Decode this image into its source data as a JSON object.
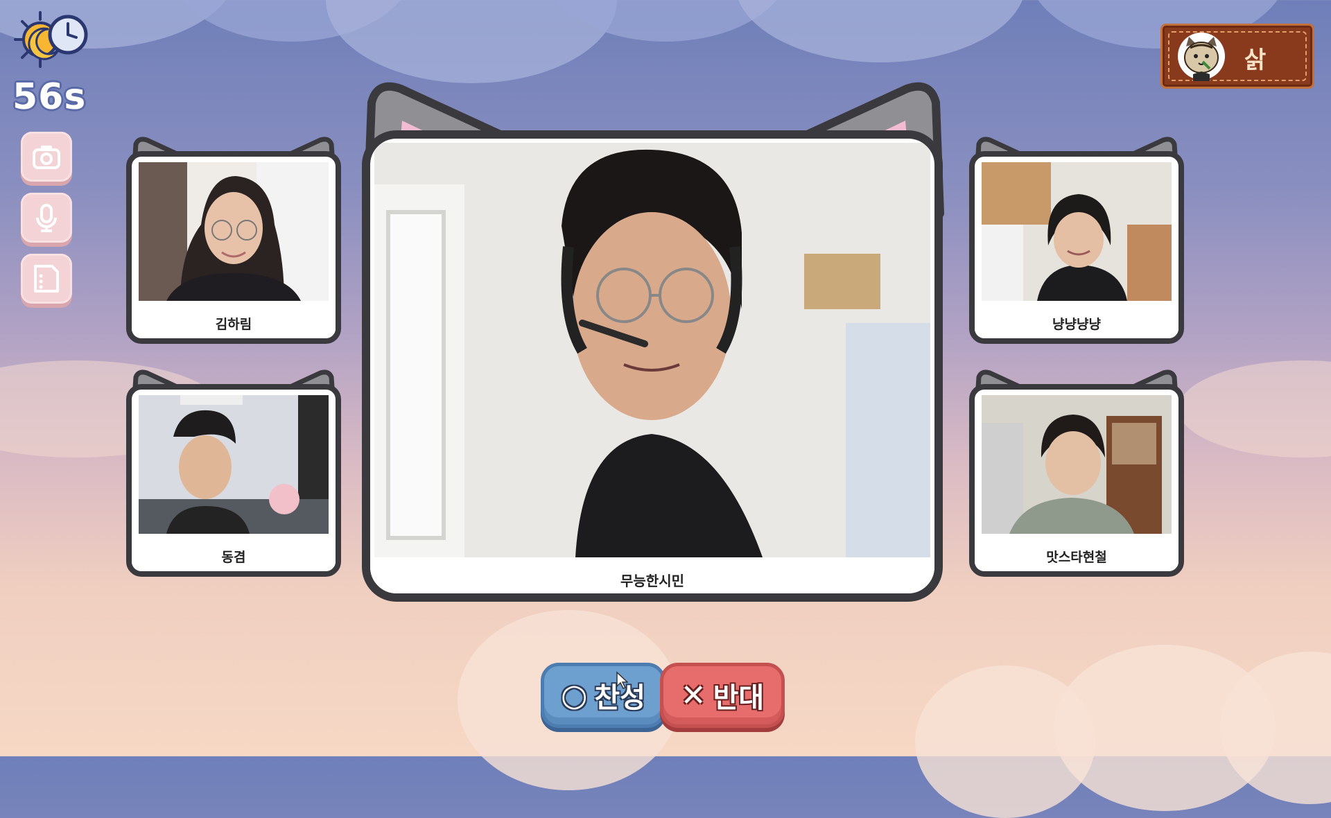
{
  "hud": {
    "timer": "56s",
    "phase_icon": "sun-moon-clock-icon",
    "buttons": [
      {
        "name": "camera-toggle-button",
        "icon": "camera-icon"
      },
      {
        "name": "microphone-toggle-button",
        "icon": "microphone-icon"
      },
      {
        "name": "memo-button",
        "icon": "memo-icon"
      }
    ]
  },
  "role": {
    "icon": "tiger-avatar-icon",
    "label": "삵"
  },
  "players": {
    "main": {
      "name": "무능한시민"
    },
    "top_left": {
      "name": "김하림"
    },
    "bottom_left": {
      "name": "동겸"
    },
    "top_right": {
      "name": "냥냥냥냥"
    },
    "bottom_right": {
      "name": "맛스타현철"
    }
  },
  "vote": {
    "agree_symbol": "○",
    "agree_label": "찬성",
    "disagree_symbol": "✕",
    "disagree_label": "반대"
  },
  "colors": {
    "frame_border": "#3a3a3e",
    "ear_outer": "#8f8f94",
    "ear_inner": "#f4bcd0",
    "agree": "#6ea0cf",
    "disagree": "#e76c6c",
    "hud_button": "#f4d3d6"
  }
}
